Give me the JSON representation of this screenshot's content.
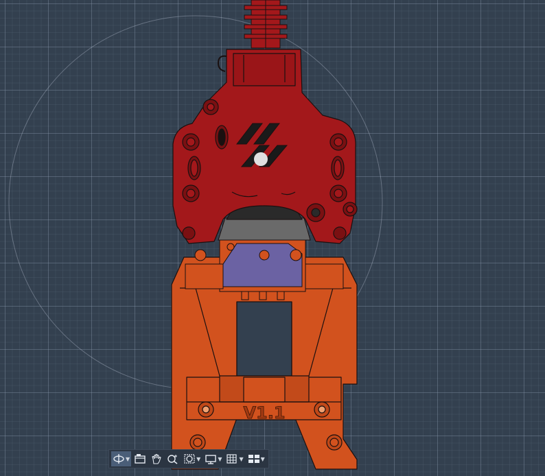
{
  "model": {
    "version_label": "V1.1"
  },
  "toolbar": {
    "items": [
      {
        "icon": "orbit-icon",
        "has_dropdown": true,
        "active": true
      },
      {
        "icon": "view-cube-icon",
        "has_dropdown": false,
        "active": false
      },
      {
        "icon": "pan-hand-icon",
        "has_dropdown": false,
        "active": false
      },
      {
        "icon": "zoom-icon",
        "has_dropdown": false,
        "active": false
      },
      {
        "icon": "zoom-window-icon",
        "has_dropdown": true,
        "active": false
      },
      {
        "icon": "display-icon",
        "has_dropdown": true,
        "active": false
      },
      {
        "icon": "grid-icon",
        "has_dropdown": true,
        "active": false
      },
      {
        "icon": "layout-icon",
        "has_dropdown": true,
        "active": false
      }
    ]
  },
  "colors": {
    "background": "#33404f",
    "part_red": "#a3181b",
    "part_orange": "#d2521e",
    "part_purple": "#6b62a3",
    "edge": "#1a1010"
  }
}
